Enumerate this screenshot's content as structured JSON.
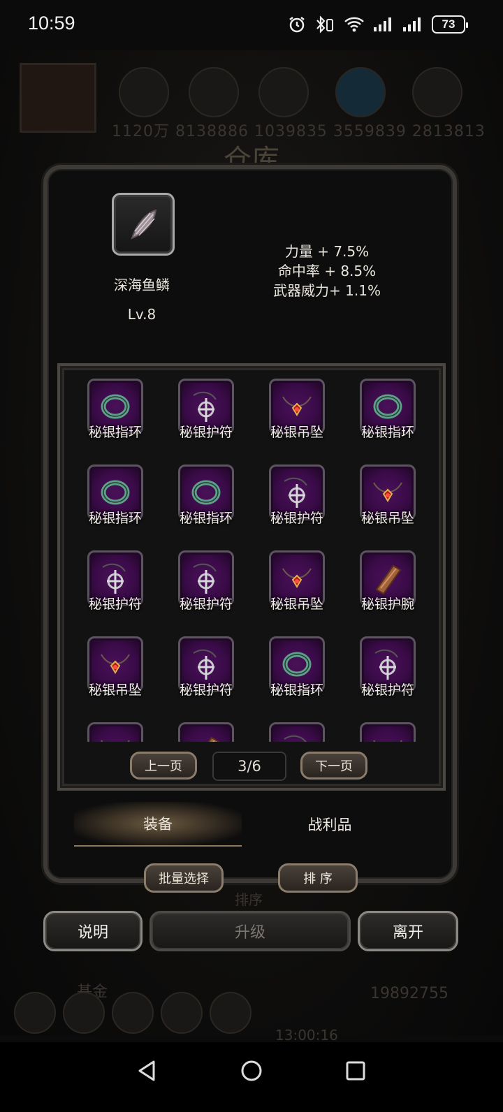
{
  "status_bar": {
    "time": "10:59",
    "battery": "73"
  },
  "background": {
    "numbers": "1120万 8138886 1039835 3559839 2813813",
    "title": "仓库",
    "sort_ghost": "排序",
    "timer": "13:00:16",
    "guild": "基金",
    "gold": "19892755"
  },
  "selected_item": {
    "name": "深海鱼鳞",
    "level": "Lv.8",
    "icon": "fish-scale-icon",
    "stats": [
      "力量 + 7.5%",
      "命中率 + 8.5%",
      "武器威力+ 1.1%"
    ]
  },
  "inventory": {
    "items": [
      {
        "label": "秘银指环",
        "icon": "ring-icon"
      },
      {
        "label": "秘银护符",
        "icon": "amulet-icon"
      },
      {
        "label": "秘银吊坠",
        "icon": "pendant-icon"
      },
      {
        "label": "秘银指环",
        "icon": "ring-icon"
      },
      {
        "label": "秘银指环",
        "icon": "ring-icon"
      },
      {
        "label": "秘银指环",
        "icon": "ring-icon"
      },
      {
        "label": "秘银护符",
        "icon": "amulet-icon"
      },
      {
        "label": "秘银吊坠",
        "icon": "pendant-icon"
      },
      {
        "label": "秘银护符",
        "icon": "amulet-icon"
      },
      {
        "label": "秘银护符",
        "icon": "amulet-icon"
      },
      {
        "label": "秘银吊坠",
        "icon": "pendant-icon"
      },
      {
        "label": "秘银护腕",
        "icon": "bracer-icon"
      },
      {
        "label": "秘银吊坠",
        "icon": "pendant-icon"
      },
      {
        "label": "秘银护符",
        "icon": "amulet-icon"
      },
      {
        "label": "秘银指环",
        "icon": "ring-icon"
      },
      {
        "label": "秘银护符",
        "icon": "amulet-icon"
      },
      {
        "label": "",
        "icon": "pendant-icon"
      },
      {
        "label": "",
        "icon": "bracer-icon"
      },
      {
        "label": "",
        "icon": "amulet-icon"
      },
      {
        "label": "",
        "icon": "pendant-icon"
      }
    ],
    "prev_label": "上一页",
    "next_label": "下一页",
    "page": "3/6"
  },
  "tabs": [
    {
      "label": "装备",
      "active": true
    },
    {
      "label": "战利品",
      "active": false
    }
  ],
  "actions": {
    "batch_select": "批量选择",
    "sort": "排 序",
    "help": "说明",
    "upgrade": "升级",
    "leave": "离开"
  },
  "colors": {
    "item_bg": "#3a0b48",
    "panel_border": "#3d3a36",
    "button_border": "#8a7c6a"
  }
}
